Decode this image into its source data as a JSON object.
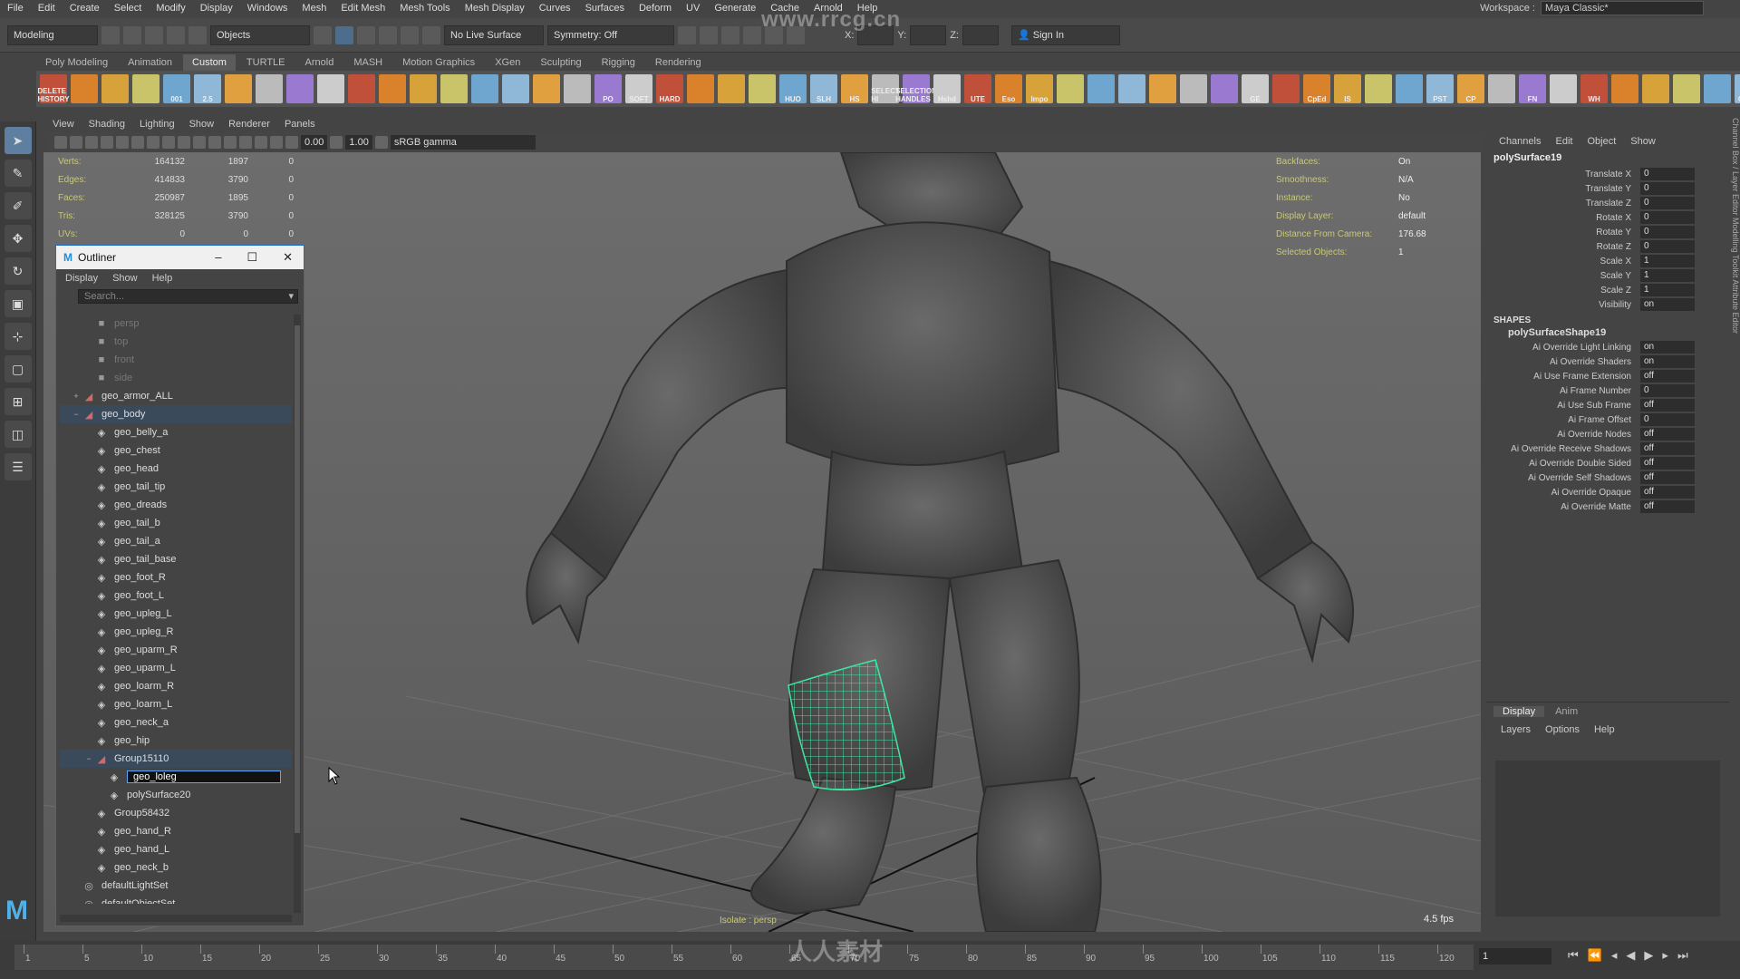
{
  "menubar": {
    "items": [
      "File",
      "Edit",
      "Create",
      "Select",
      "Modify",
      "Display",
      "Windows",
      "Mesh",
      "Edit Mesh",
      "Mesh Tools",
      "Mesh Display",
      "Curves",
      "Surfaces",
      "Deform",
      "UV",
      "Generate",
      "Cache",
      "Arnold",
      "Help"
    ],
    "workspace_label": "Workspace :",
    "workspace_value": "Maya Classic*"
  },
  "statusline": {
    "mode": "Modeling",
    "objects": "Objects",
    "live_surface": "No Live Surface",
    "symmetry": "Symmetry: Off",
    "x_label": "X:",
    "y_label": "Y:",
    "z_label": "Z:",
    "sign_in": "Sign In"
  },
  "shelf": {
    "tabs": [
      "Poly Modeling",
      "Animation",
      "Custom",
      "TURTLE",
      "Arnold",
      "MASH",
      "Motion Graphics",
      "XGen",
      "Sculpting",
      "Rigging",
      "Rendering"
    ],
    "active_tab": "Custom",
    "buttons": [
      "DELETE HISTORY",
      "",
      "",
      "",
      "001",
      "2.5",
      "",
      "",
      "",
      "",
      "",
      "",
      "",
      "",
      "",
      "",
      "",
      "",
      "PO",
      "SOFT",
      "HARD",
      "",
      "",
      "",
      "HUO",
      "SLH",
      "HS",
      "SELECT HI",
      "SELECTION HANDLES",
      "Hshd",
      "UTE",
      "Eso",
      "Impo",
      "",
      "",
      "",
      "",
      "",
      "",
      "GE",
      "",
      "CpEd",
      "IS",
      "",
      "",
      "PST",
      "CP",
      "",
      "FN",
      "",
      "WH",
      "",
      "",
      "",
      "",
      "Quick"
    ]
  },
  "viewport": {
    "menu": [
      "View",
      "Shading",
      "Lighting",
      "Show",
      "Renderer",
      "Panels"
    ],
    "num1": "0.00",
    "num2": "1.00",
    "colorspace": "sRGB gamma",
    "hud_left": [
      {
        "k": "Verts:",
        "v1": "164132",
        "v2": "1897",
        "v3": "0"
      },
      {
        "k": "Edges:",
        "v1": "414833",
        "v2": "3790",
        "v3": "0"
      },
      {
        "k": "Faces:",
        "v1": "250987",
        "v2": "1895",
        "v3": "0"
      },
      {
        "k": "Tris:",
        "v1": "328125",
        "v2": "3790",
        "v3": "0"
      },
      {
        "k": "UVs:",
        "v1": "0",
        "v2": "0",
        "v3": "0"
      }
    ],
    "hud_right": [
      {
        "k": "Backfaces:",
        "v": "On"
      },
      {
        "k": "Smoothness:",
        "v": "N/A"
      },
      {
        "k": "Instance:",
        "v": "No"
      },
      {
        "k": "Display Layer:",
        "v": "default"
      },
      {
        "k": "Distance From Camera:",
        "v": "176.68"
      },
      {
        "k": "Selected Objects:",
        "v": "1"
      }
    ],
    "isolate": "Isolate : persp",
    "fps": "4.5 fps"
  },
  "outliner": {
    "title": "Outliner",
    "menu": [
      "Display",
      "Show",
      "Help"
    ],
    "search_placeholder": "Search...",
    "rows": [
      {
        "label": "persp",
        "type": "cam",
        "indent": 1,
        "dim": true
      },
      {
        "label": "top",
        "type": "cam",
        "indent": 1,
        "dim": true
      },
      {
        "label": "front",
        "type": "cam",
        "indent": 1,
        "dim": true
      },
      {
        "label": "side",
        "type": "cam",
        "indent": 1,
        "dim": true
      },
      {
        "label": "geo_armor_ALL",
        "type": "grp",
        "indent": 0,
        "exp": "+"
      },
      {
        "label": "geo_body",
        "type": "grp",
        "indent": 0,
        "exp": "−",
        "hl": true
      },
      {
        "label": "geo_belly_a",
        "type": "mesh",
        "indent": 1
      },
      {
        "label": "geo_chest",
        "type": "mesh",
        "indent": 1
      },
      {
        "label": "geo_head",
        "type": "mesh",
        "indent": 1
      },
      {
        "label": "geo_tail_tip",
        "type": "mesh",
        "indent": 1
      },
      {
        "label": "geo_dreads",
        "type": "mesh",
        "indent": 1
      },
      {
        "label": "geo_tail_b",
        "type": "mesh",
        "indent": 1
      },
      {
        "label": "geo_tail_a",
        "type": "mesh",
        "indent": 1
      },
      {
        "label": "geo_tail_base",
        "type": "mesh",
        "indent": 1
      },
      {
        "label": "geo_foot_R",
        "type": "mesh",
        "indent": 1
      },
      {
        "label": "geo_foot_L",
        "type": "mesh",
        "indent": 1
      },
      {
        "label": "geo_upleg_L",
        "type": "mesh",
        "indent": 1
      },
      {
        "label": "geo_upleg_R",
        "type": "mesh",
        "indent": 1
      },
      {
        "label": "geo_uparm_R",
        "type": "mesh",
        "indent": 1
      },
      {
        "label": "geo_uparm_L",
        "type": "mesh",
        "indent": 1
      },
      {
        "label": "geo_loarm_R",
        "type": "mesh",
        "indent": 1
      },
      {
        "label": "geo_loarm_L",
        "type": "mesh",
        "indent": 1
      },
      {
        "label": "geo_neck_a",
        "type": "mesh",
        "indent": 1
      },
      {
        "label": "geo_hip",
        "type": "mesh",
        "indent": 1
      },
      {
        "label": "Group15110",
        "type": "grp",
        "indent": 1,
        "exp": "−",
        "hl": true
      },
      {
        "label": "geo_loleg",
        "type": "mesh",
        "indent": 2,
        "sel": true
      },
      {
        "label": "polySurface20",
        "type": "mesh",
        "indent": 2
      },
      {
        "label": "Group58432",
        "type": "mesh",
        "indent": 1
      },
      {
        "label": "geo_hand_R",
        "type": "mesh",
        "indent": 1
      },
      {
        "label": "geo_hand_L",
        "type": "mesh",
        "indent": 1
      },
      {
        "label": "geo_neck_b",
        "type": "mesh",
        "indent": 1
      },
      {
        "label": "defaultLightSet",
        "type": "set",
        "indent": 0
      },
      {
        "label": "defaultObjectSet",
        "type": "set",
        "indent": 0
      }
    ]
  },
  "channelbox": {
    "menu": [
      "Channels",
      "Edit",
      "Object",
      "Show"
    ],
    "node": "polySurface19",
    "channels": [
      {
        "k": "Translate X",
        "v": "0"
      },
      {
        "k": "Translate Y",
        "v": "0"
      },
      {
        "k": "Translate Z",
        "v": "0"
      },
      {
        "k": "Rotate X",
        "v": "0"
      },
      {
        "k": "Rotate Y",
        "v": "0"
      },
      {
        "k": "Rotate Z",
        "v": "0"
      },
      {
        "k": "Scale X",
        "v": "1"
      },
      {
        "k": "Scale Y",
        "v": "1"
      },
      {
        "k": "Scale Z",
        "v": "1"
      },
      {
        "k": "Visibility",
        "v": "on"
      }
    ],
    "shapes_label": "SHAPES",
    "shape_name": "polySurfaceShape19",
    "shape_attrs": [
      {
        "k": "Ai Override Light Linking",
        "v": "on"
      },
      {
        "k": "Ai Override Shaders",
        "v": "on"
      },
      {
        "k": "Ai Use Frame Extension",
        "v": "off"
      },
      {
        "k": "Ai Frame Number",
        "v": "0"
      },
      {
        "k": "Ai Use Sub Frame",
        "v": "off"
      },
      {
        "k": "Ai Frame Offset",
        "v": "0"
      },
      {
        "k": "Ai Override Nodes",
        "v": "off"
      },
      {
        "k": "Ai Override Receive Shadows",
        "v": "off"
      },
      {
        "k": "Ai Override Double Sided",
        "v": "off"
      },
      {
        "k": "Ai Override Self Shadows",
        "v": "off"
      },
      {
        "k": "Ai Override Opaque",
        "v": "off"
      },
      {
        "k": "Ai Override Matte",
        "v": "off"
      }
    ],
    "side_tabs": "Channel Box / Layer Editor   Modelling Toolkit   Attribute Editor"
  },
  "layers": {
    "tabs": [
      "Display",
      "Anim"
    ],
    "menu": [
      "Layers",
      "Options",
      "Help"
    ]
  },
  "timeline": {
    "ticks": [
      "1",
      "5",
      "10",
      "15",
      "20",
      "25",
      "30",
      "35",
      "40",
      "45",
      "50",
      "55",
      "60",
      "65",
      "70",
      "75",
      "80",
      "85",
      "90",
      "95",
      "100",
      "105",
      "110",
      "115",
      "120"
    ],
    "current_frame": "1"
  },
  "watermark": {
    "top": "www.rrcg.cn",
    "bottom": "人人素材"
  },
  "colors": {
    "accent": "#5285a6",
    "wireframe": "#3ee6a3",
    "hud_label": "#c8c87a"
  }
}
